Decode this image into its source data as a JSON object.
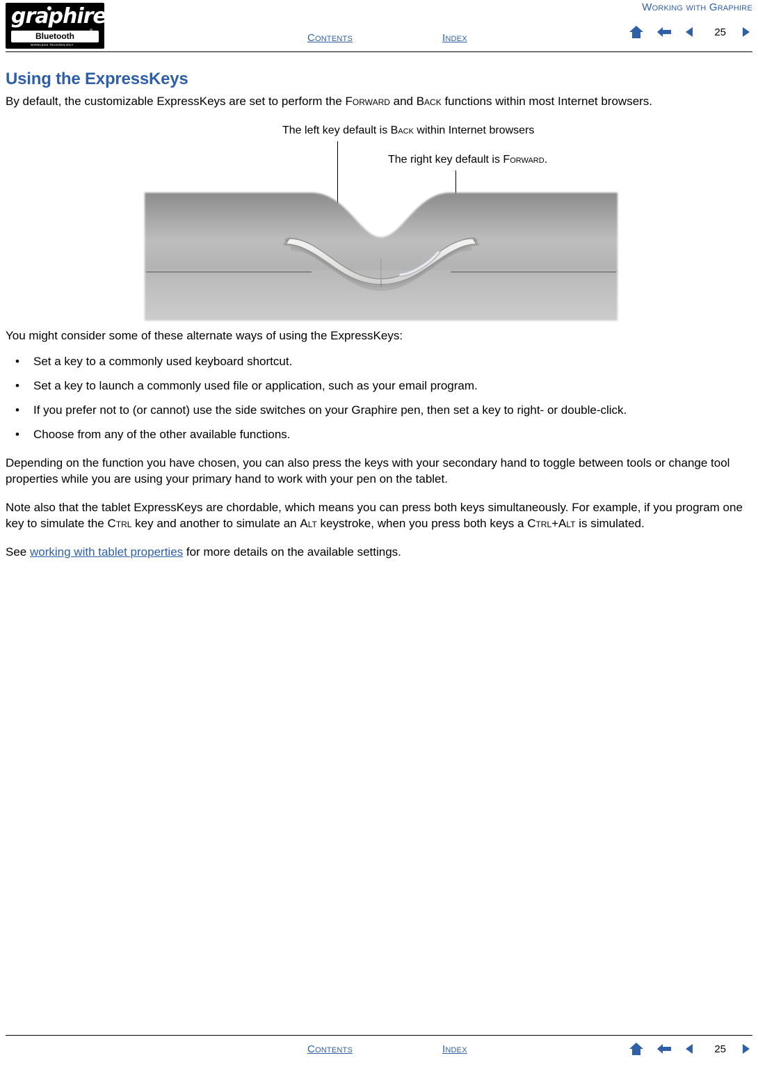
{
  "document": {
    "header_title": "Working with Graphire",
    "page_number": "25",
    "logo": {
      "word": "graphire",
      "badge": "Bluetooth",
      "trademark": "®",
      "tagline": "WIRELESS TECHNOLOGY"
    },
    "nav": {
      "contents": "Contents",
      "index": "Index",
      "home_icon": "home-icon",
      "prev_icon": "previous-page-icon",
      "back_icon": "back-page-icon",
      "next_icon": "next-page-icon"
    }
  },
  "main": {
    "title": "Using the ExpressKeys",
    "intro_pre": "By default, the customizable ExpressKeys are set to perform the ",
    "intro_forward": "Forward",
    "intro_mid": " and ",
    "intro_back": "Back",
    "intro_post": " functions within most Internet browsers.",
    "figure": {
      "callout_left_pre": "The left key default is ",
      "callout_left_sc": "Back",
      "callout_left_post": " within Internet browsers",
      "callout_right_pre": "The right key default is ",
      "callout_right_sc": "Forward",
      "callout_right_post": ".",
      "image_alt": "graphire-tablet-expresskeys-illustration"
    },
    "alt_ways_intro": "You might consider some of these alternate ways of using the ExpressKeys:",
    "bullets": [
      "Set a key to a commonly used keyboard shortcut.",
      "Set a key to launch a commonly used file or application, such as your email program.",
      "If you prefer not to (or cannot) use the side switches on your Graphire pen, then set a key to right- or double-click.",
      "Choose from any of the other available functions."
    ],
    "paragraph_depending": "Depending on the function you have chosen, you can also press the keys with your secondary hand to toggle between tools or change tool properties while you are using your primary hand to work with your pen on the tablet.",
    "note_pre": "Note also that the tablet ExpressKeys are chordable, which means you can press both keys simultaneously. For example, if you program one key to simulate the ",
    "note_ctrl": "Ctrl",
    "note_mid": " key and another to simulate an ",
    "note_alt": "Alt",
    "note_mid2": " keystroke, when you press both keys a ",
    "note_ctrlalt": "Ctrl+Alt",
    "note_post": " is simulated.",
    "see_pre": "See ",
    "see_link": "working with tablet properties",
    "see_post": " for more details on the available settings."
  },
  "colors": {
    "link": "#2f5fa8",
    "text": "#000000",
    "background": "#ffffff"
  }
}
